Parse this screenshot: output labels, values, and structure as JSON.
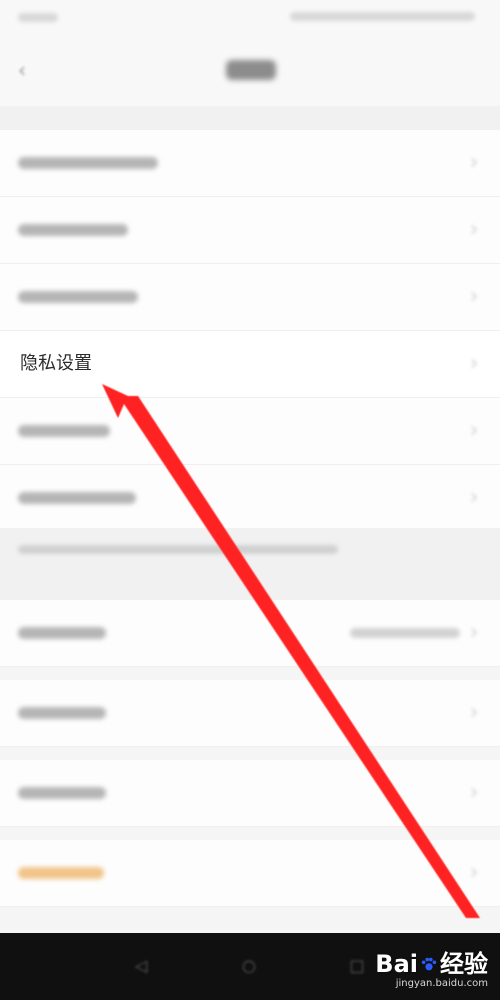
{
  "header": {
    "back_icon": "back-arrow-icon"
  },
  "settings": {
    "privacy_label": "隐私设置"
  },
  "colors": {
    "arrow": "#ff1f1f",
    "accent_orange": "#f1c489",
    "navbar": "#101010"
  },
  "watermark": {
    "brand_prefix": "Bai",
    "brand_suffix": "经验",
    "url": "jingyan.baidu.com"
  }
}
